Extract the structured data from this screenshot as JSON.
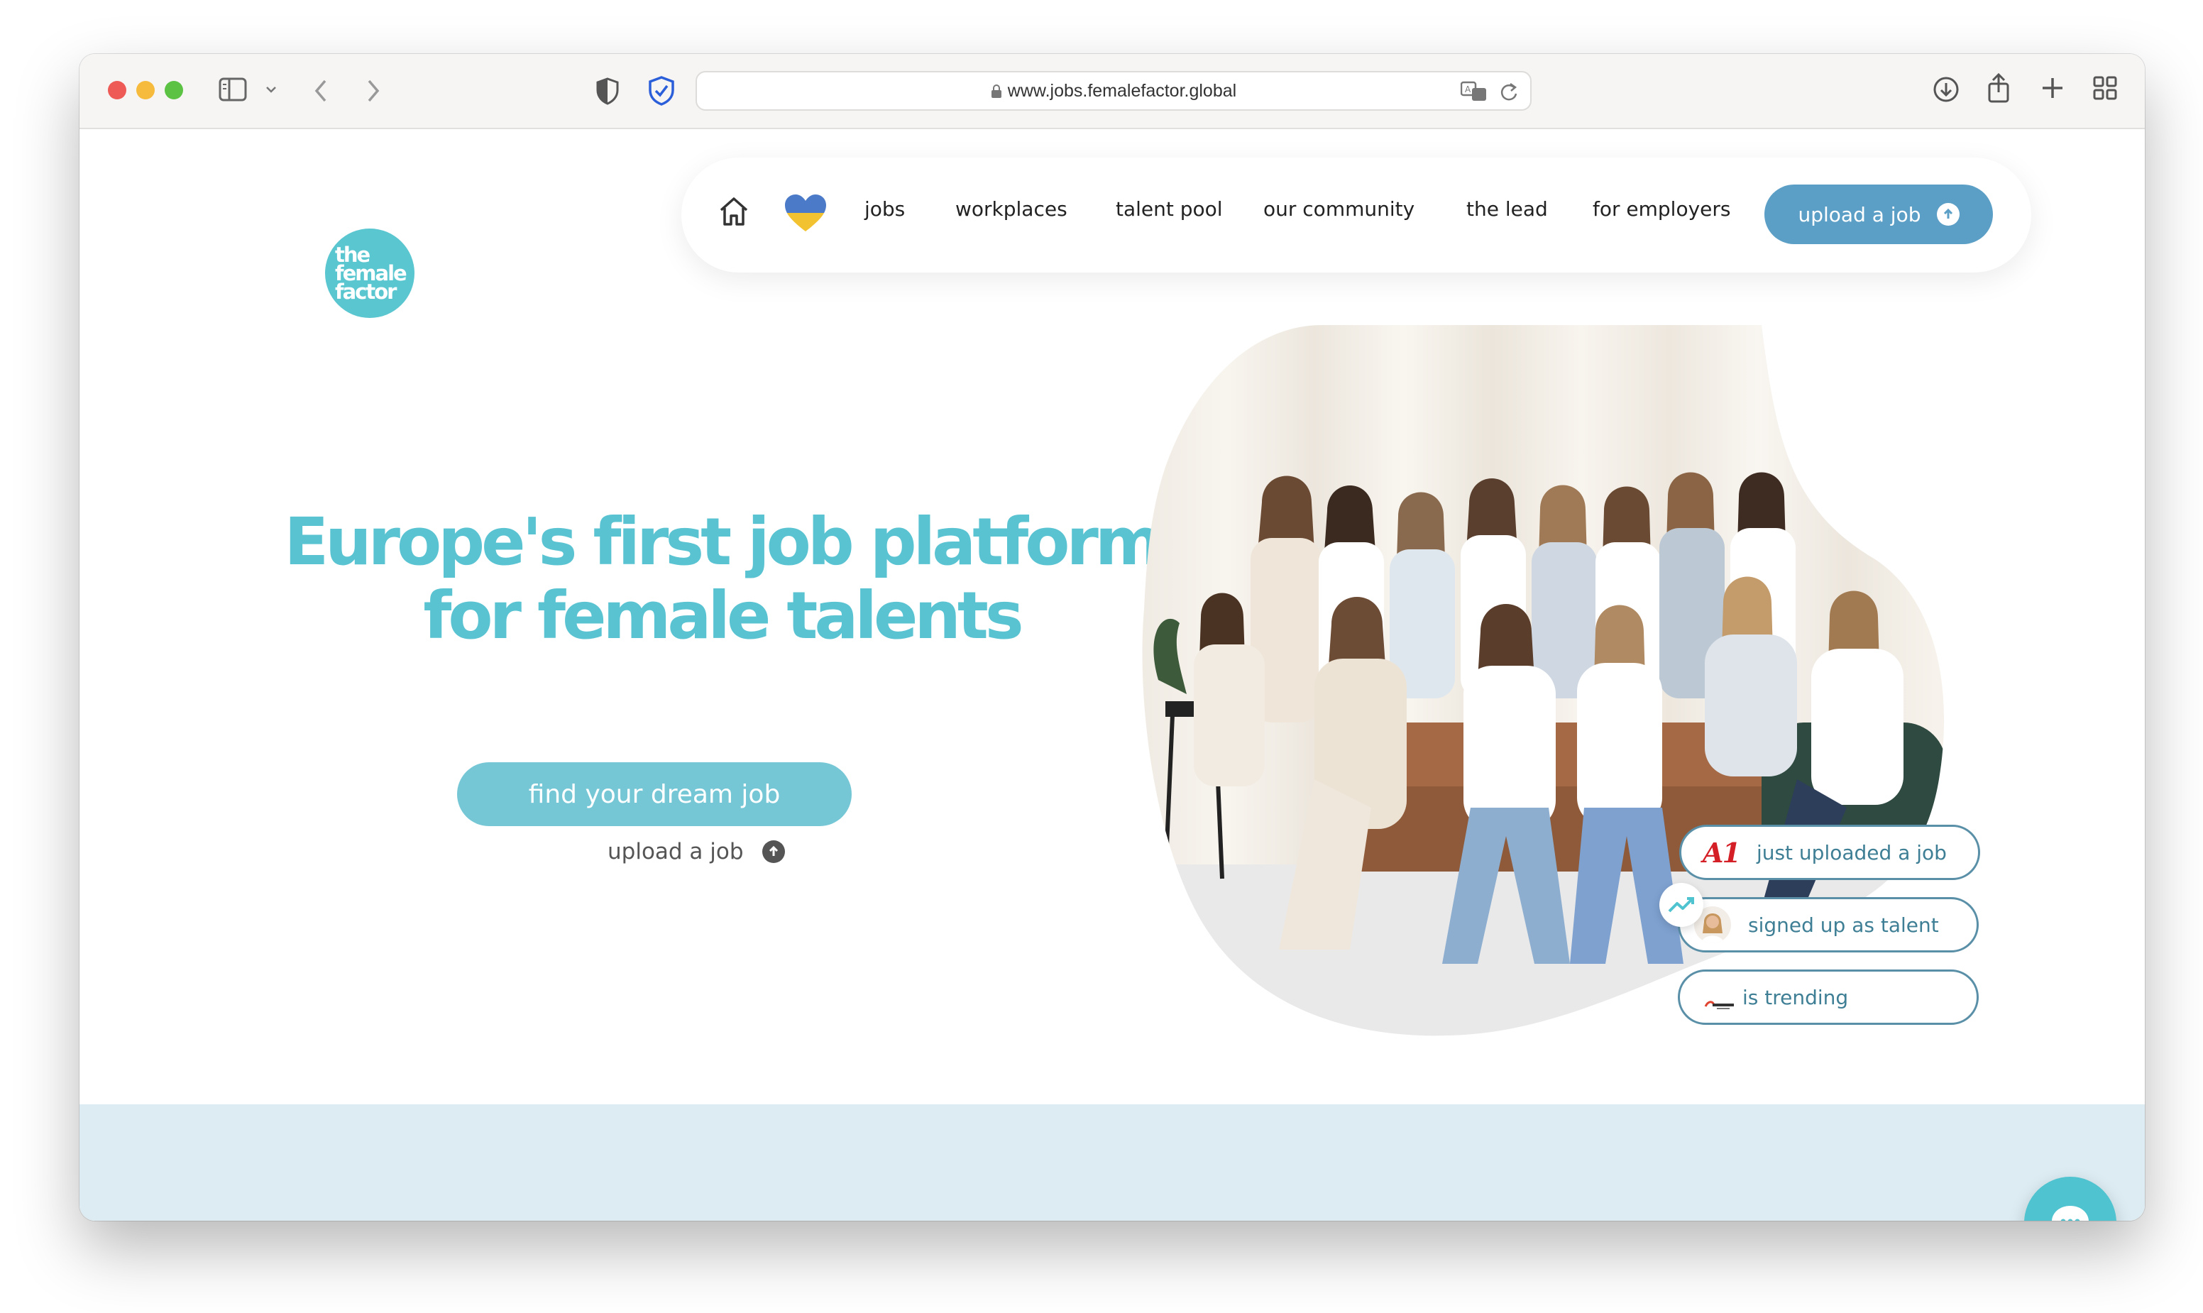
{
  "browser": {
    "url": "www.jobs.femalefactor.global"
  },
  "logo": {
    "lines": [
      "the",
      "female",
      "factor"
    ]
  },
  "nav": {
    "items": [
      {
        "label": "jobs"
      },
      {
        "label": "workplaces"
      },
      {
        "label": "talent pool"
      },
      {
        "label": "our community"
      },
      {
        "label": "the lead"
      },
      {
        "label": "for employers"
      }
    ],
    "cta_label": "upload a job"
  },
  "hero": {
    "title_line1": "Europe's first job platform",
    "title_line2": "for female talents",
    "primary_cta": "find your dream job",
    "secondary_cta": "upload a job"
  },
  "activity": {
    "items": [
      {
        "brand": "A1",
        "text": "just uploaded a job"
      },
      {
        "text": "signed up as talent"
      },
      {
        "text": "is trending"
      }
    ]
  },
  "colors": {
    "brand_teal": "#59c3d2",
    "nav_cta_blue": "#5c9fc6",
    "band_light_blue": "#dcecf2"
  }
}
